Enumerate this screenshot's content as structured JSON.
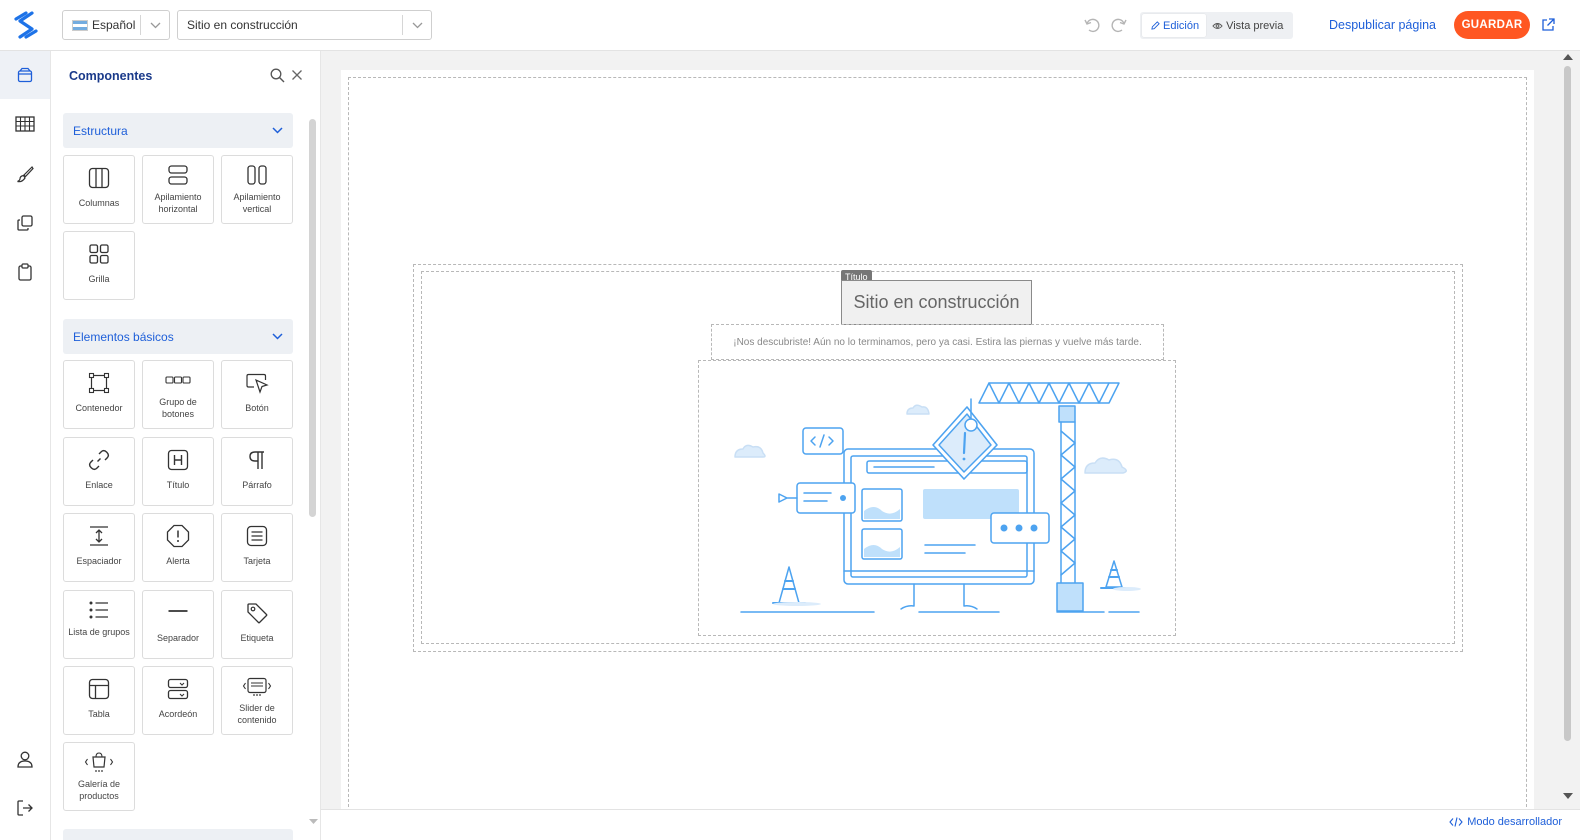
{
  "topbar": {
    "language": "Español",
    "page": "Sitio en construcción",
    "mode_edit": "Edición",
    "mode_preview": "Vista previa",
    "unpublish": "Despublicar página",
    "save": "GUARDAR"
  },
  "rail": {
    "items": [
      "box-icon",
      "table-icon",
      "brush-icon",
      "copy-icon",
      "clipboard-icon",
      "user-icon",
      "logout-icon"
    ]
  },
  "panel": {
    "title": "Componentes",
    "sections": [
      {
        "label": "Estructura",
        "items": [
          "Columnas",
          "Apilamiento horizontal",
          "Apilamiento vertical",
          "Grilla"
        ]
      },
      {
        "label": "Elementos básicos",
        "items": [
          "Contenedor",
          "Grupo de botones",
          "Botón",
          "Enlace",
          "Título",
          "Párrafo",
          "Espaciador",
          "Alerta",
          "Tarjeta",
          "Lista de grupos",
          "Separador",
          "Etiqueta",
          "Tabla",
          "Acordeón",
          "Slider de contenido",
          "Galería de productos"
        ]
      }
    ]
  },
  "canvas": {
    "title_tag": "Título",
    "heading": "Sitio en construcción",
    "subtitle": "¡Nos descubriste! Aún no lo terminamos, pero ya casi. Estira las piernas y vuelve más tarde."
  },
  "bottom": {
    "dev_mode": "Modo desarrollador"
  },
  "colors": {
    "accent": "#1e5fd9",
    "save": "#ff5722",
    "illustration": "#4da3f0"
  }
}
